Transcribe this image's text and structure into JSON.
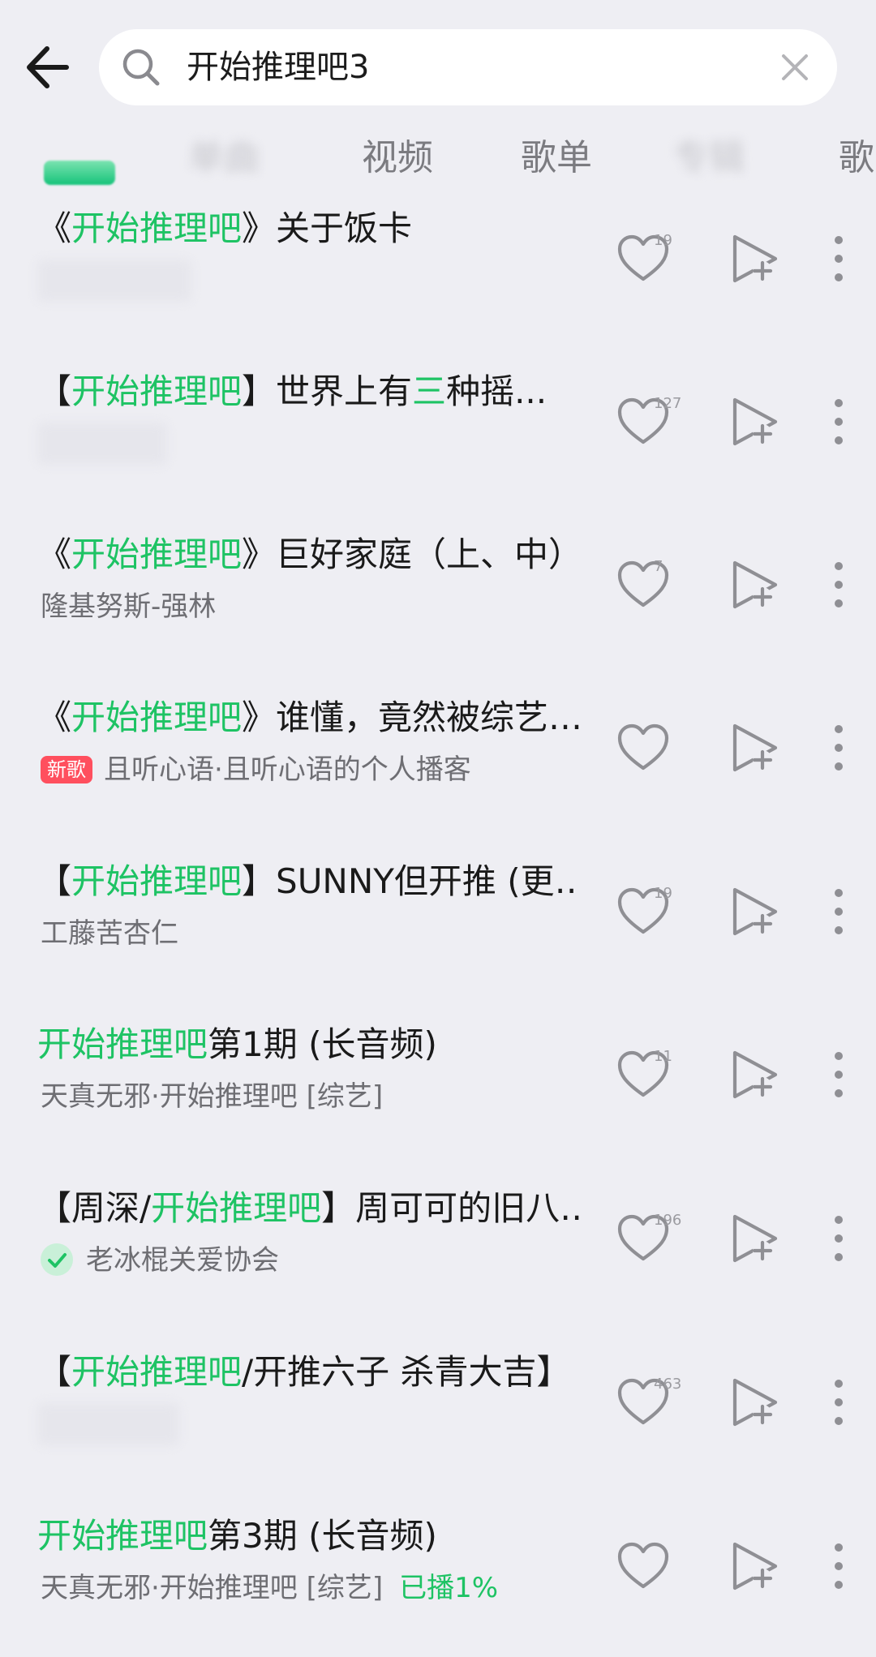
{
  "search": {
    "query": "开始推理吧3"
  },
  "tabs": [
    {
      "label": "单曲"
    },
    {
      "label": "视频"
    },
    {
      "label": "歌单"
    },
    {
      "label": "专辑"
    },
    {
      "label": "歌"
    }
  ],
  "rows": [
    {
      "title_parts": [
        "《",
        "开始推理吧",
        "》关于饭卡"
      ],
      "subtitle": "",
      "count": "19"
    },
    {
      "title_parts": [
        "【",
        "开始推理吧",
        "】世界上有",
        "三",
        "种摇..."
      ],
      "subtitle": "",
      "count": "127"
    },
    {
      "title_parts": [
        "《",
        "开始推理吧",
        "》巨好家庭（上、中）…"
      ],
      "subtitle": "隆基努斯-强林",
      "count": "7"
    },
    {
      "title_parts": [
        "《",
        "开始推理吧",
        "》谁懂，竟然被综艺…"
      ],
      "badge": "新歌",
      "subtitle": "且听心语·且听心语的个人播客",
      "count": ""
    },
    {
      "title_parts": [
        "【",
        "开始推理吧",
        "】SUNNY但开推 (更…"
      ],
      "subtitle": "工藤苦杏仁",
      "count": "19"
    },
    {
      "title_parts": [
        "",
        "开始推理吧",
        "第1期 (长音频)"
      ],
      "subtitle": "天真无邪·开始推理吧 [综艺]",
      "count": "11"
    },
    {
      "title_parts": [
        "【周深/",
        "开始推理吧",
        "】周可可的旧八…"
      ],
      "subtitle": "老冰棍关爱协会",
      "count": "196"
    },
    {
      "title_parts": [
        "【",
        "开始推理吧",
        "/开推六子 杀青大吉】"
      ],
      "subtitle": "",
      "count": "463"
    },
    {
      "title_parts": [
        "",
        "开始推理吧",
        "第3期 (长音频)"
      ],
      "subtitle": "天真无邪·开始推理吧 [综艺]",
      "progress": "已播1%",
      "count": ""
    }
  ],
  "colors": {
    "accent": "#1ec364",
    "badge": "#ff4f5e",
    "background": "#eeeef3"
  }
}
